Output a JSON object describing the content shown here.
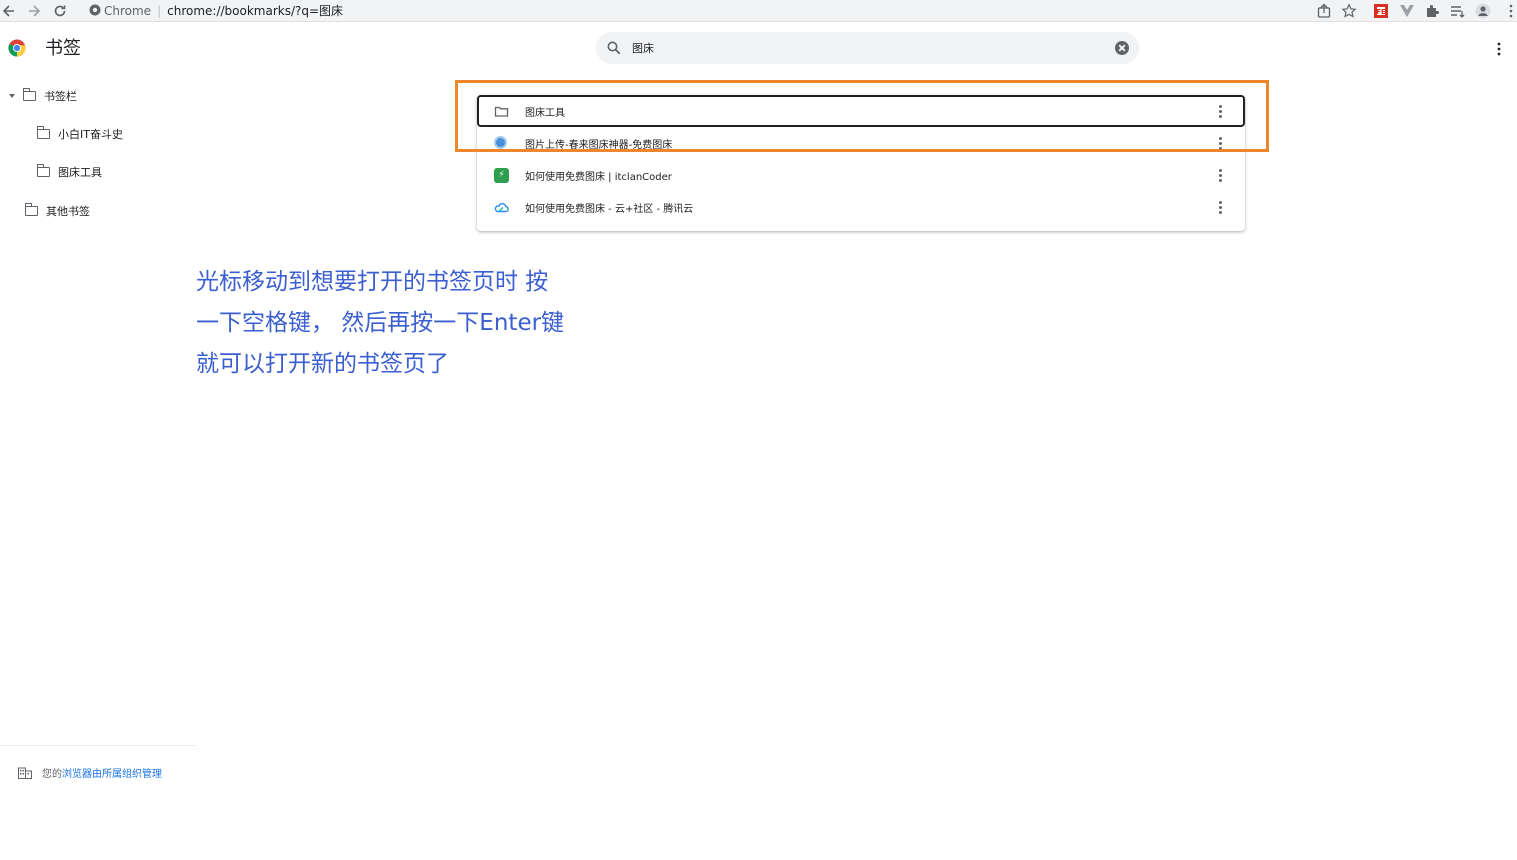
{
  "browser": {
    "omnibox_label": "Chrome",
    "url": "chrome://bookmarks/?q=图床"
  },
  "header": {
    "title": "书签",
    "search_value": "图床"
  },
  "sidebar": {
    "items": [
      {
        "label": "书签栏"
      },
      {
        "label": "小白IT奋斗史"
      },
      {
        "label": "图床工具"
      },
      {
        "label": "其他书签"
      }
    ],
    "managed_prefix": "您的",
    "managed_link": "浏览器由所属组织管理"
  },
  "results": [
    {
      "label": "图床工具",
      "icon": "folder-icon"
    },
    {
      "label": "图片上传-春来图床神器-免费图床",
      "icon": "globe-favicon"
    },
    {
      "label": "如何使用免费图床 | itclanCoder",
      "icon": "itclan-favicon"
    },
    {
      "label": "如何使用免费图床 - 云+社区 - 腾讯云",
      "icon": "tencent-cloud-favicon"
    }
  ],
  "annotation": {
    "line1": "光标移动到想要打开的书签页时 按",
    "line2": "一下空格键， 然后再按一下Enter键",
    "line3": "就可以打开新的书签页了"
  },
  "colors": {
    "highlight": "#f0862c",
    "annotation_text": "#3b5fd1",
    "link": "#1a73e8"
  }
}
